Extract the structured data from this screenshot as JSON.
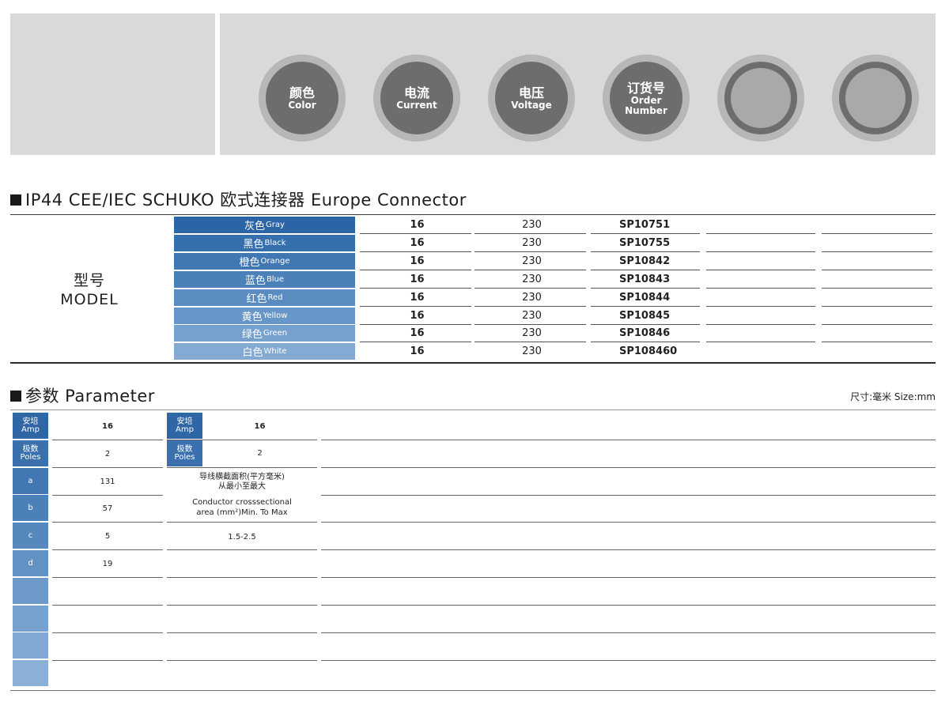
{
  "header": {
    "badges": [
      {
        "cn": "颜色",
        "en": "Color"
      },
      {
        "cn": "电流",
        "en": "Current"
      },
      {
        "cn": "电压",
        "en": "Voltage"
      },
      {
        "cn": "订货号",
        "en": "Order Number"
      },
      {
        "cn": "",
        "en": ""
      },
      {
        "cn": "",
        "en": ""
      }
    ]
  },
  "model_section": {
    "title": "IP44 CEE/IEC SCHUKO 欧式连接器  Europe Connector",
    "label_cn": "型号",
    "label_en": "MODEL",
    "rows": [
      {
        "color_cn": "灰色",
        "color_en": "Gray",
        "current": "16",
        "voltage": "230",
        "order": "SP10751",
        "swatch": "#2c65a6"
      },
      {
        "color_cn": "黑色",
        "color_en": "Black",
        "current": "16",
        "voltage": "230",
        "order": "SP10755",
        "swatch": "#366fad"
      },
      {
        "color_cn": "橙色",
        "color_en": "Orange",
        "current": "16",
        "voltage": "230",
        "order": "SP10842",
        "swatch": "#4177b3"
      },
      {
        "color_cn": "蓝色",
        "color_en": "Blue",
        "current": "16",
        "voltage": "230",
        "order": "SP10843",
        "swatch": "#4c80b9"
      },
      {
        "color_cn": "红色",
        "color_en": "Red",
        "current": "16",
        "voltage": "230",
        "order": "SP10844",
        "swatch": "#5a8cc1"
      },
      {
        "color_cn": "黄色",
        "color_en": "Yellow",
        "current": "16",
        "voltage": "230",
        "order": "SP10845",
        "swatch": "#6896c8"
      },
      {
        "color_cn": "绿色",
        "color_en": "Green",
        "current": "16",
        "voltage": "230",
        "order": "SP10846",
        "swatch": "#76a0ce"
      },
      {
        "color_cn": "白色",
        "color_en": "White",
        "current": "16",
        "voltage": "230",
        "order": "SP108460",
        "swatch": "#83aad3"
      }
    ]
  },
  "param_section": {
    "title": "参数 Parameter",
    "unit_note": "尺寸:毫米  Size:mm",
    "left_rows": [
      {
        "cn": "安培",
        "en": "Amp",
        "value": "16",
        "bold": true,
        "swatch": "#2f66a6"
      },
      {
        "cn": "极数",
        "en": "Poles",
        "value": "2",
        "bold": false,
        "swatch": "#3970ad"
      },
      {
        "cn": "",
        "en": "a",
        "value": "131",
        "bold": false,
        "swatch": "#4178b3"
      },
      {
        "cn": "",
        "en": "b",
        "value": "57",
        "bold": false,
        "swatch": "#4c80b9"
      },
      {
        "cn": "",
        "en": "c",
        "value": "5",
        "bold": false,
        "swatch": "#5688be"
      },
      {
        "cn": "",
        "en": "d",
        "value": "19",
        "bold": false,
        "swatch": "#6291c4"
      },
      {
        "cn": "",
        "en": "",
        "value": "",
        "bold": false,
        "swatch": "#6d99c9"
      },
      {
        "cn": "",
        "en": "",
        "value": "",
        "bold": false,
        "swatch": "#77a1ce"
      },
      {
        "cn": "",
        "en": "",
        "value": "",
        "bold": false,
        "swatch": "#82a9d2"
      },
      {
        "cn": "",
        "en": "",
        "value": "",
        "bold": false,
        "swatch": "#8bb0d6"
      }
    ],
    "right_rows": [
      {
        "cn": "安培",
        "en": "Amp",
        "value": "16",
        "bold": true
      },
      {
        "cn": "极数",
        "en": "Poles",
        "value": "2",
        "bold": false
      }
    ],
    "conductor": {
      "cn_line1": "导线横截面积(平方毫米)",
      "cn_line2": "从最小至最大",
      "en_line1": "Conductor crosssectional",
      "en_line2": "area (mm²)Min. To Max",
      "range": "1.5-2.5"
    }
  }
}
